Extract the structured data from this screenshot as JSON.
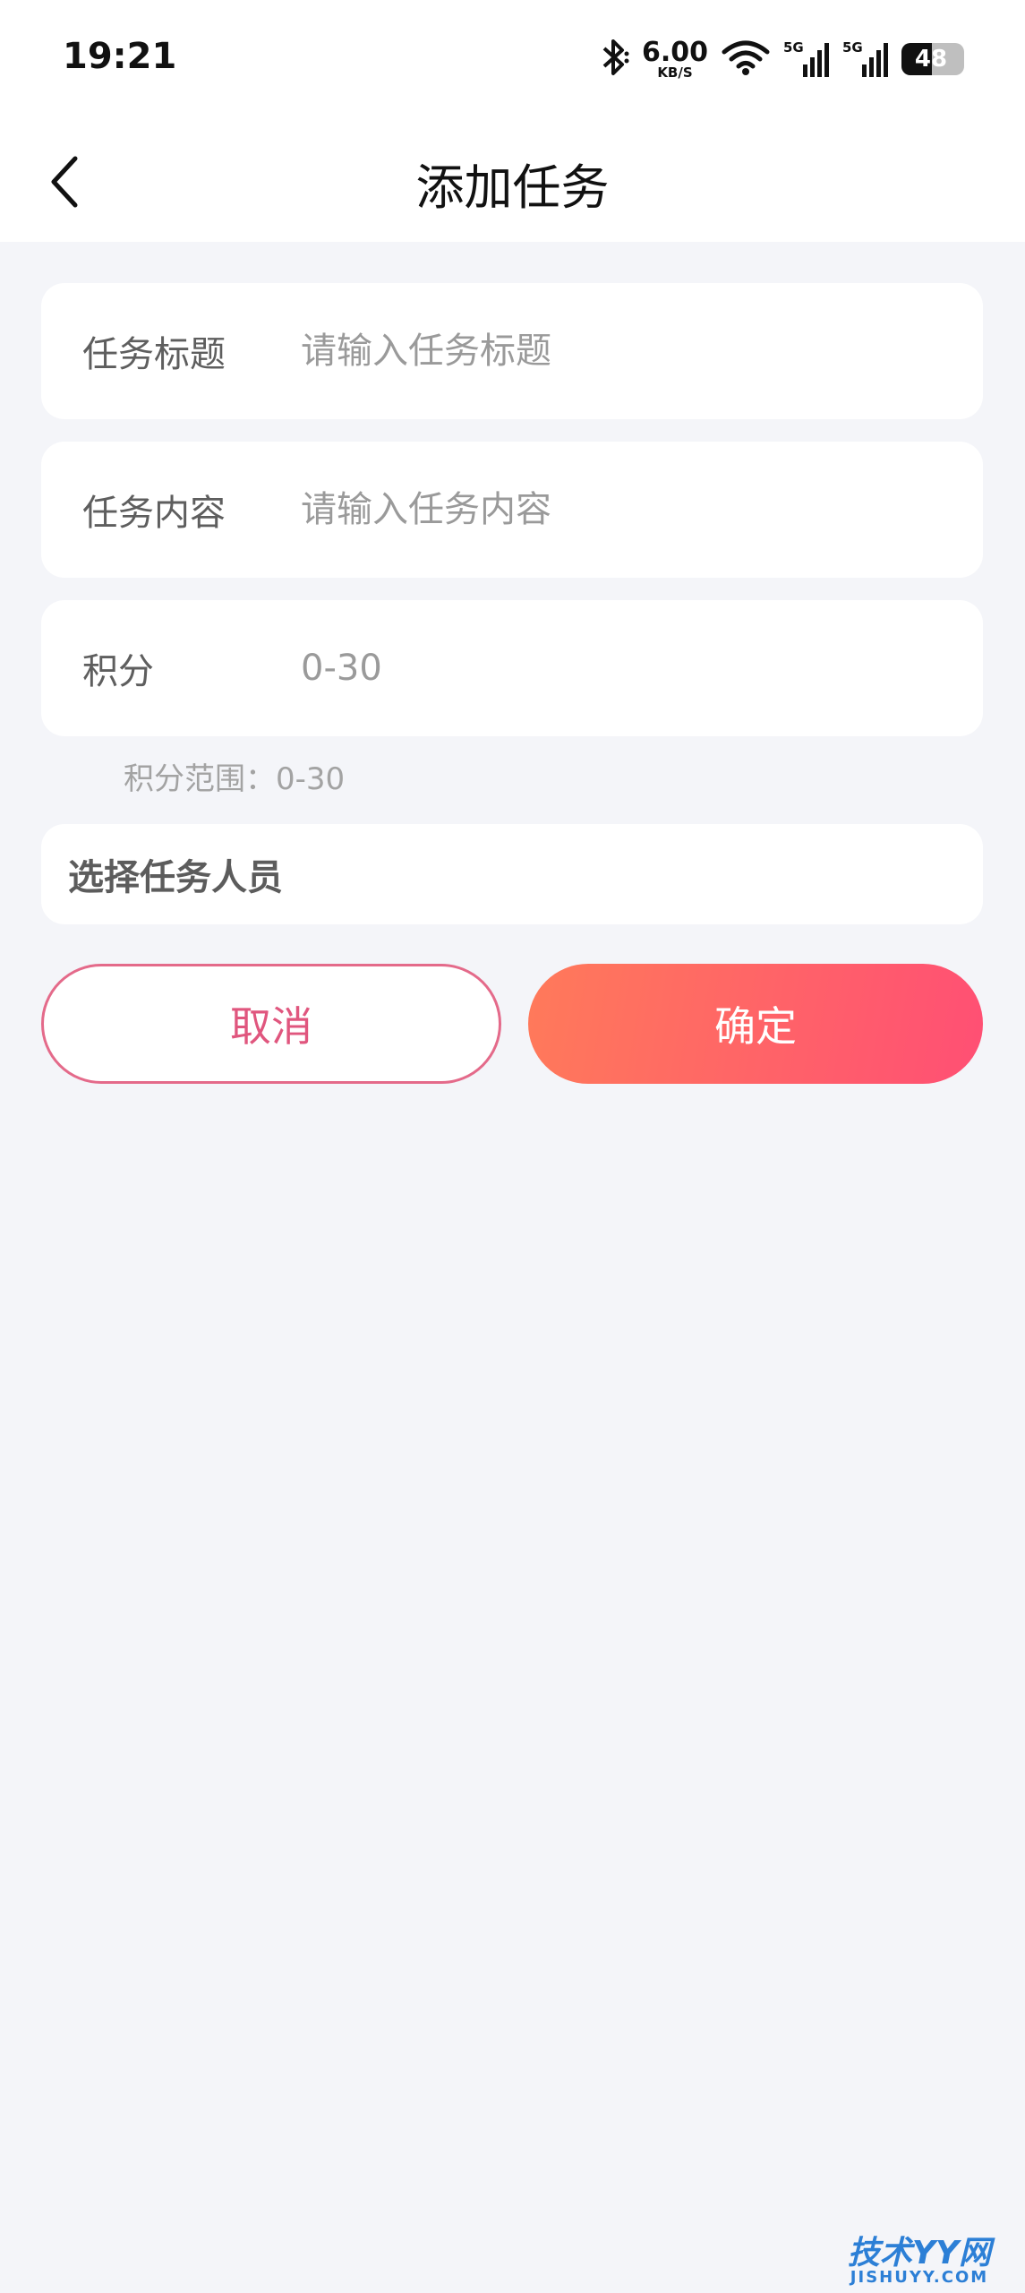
{
  "status_bar": {
    "time": "19:21",
    "net_speed": "6.00",
    "net_unit": "KB/S",
    "sim1_label": "5G",
    "sim2_label": "5G",
    "battery_level": "48",
    "battery_fraction": 0.48,
    "icons": [
      "bluetooth-icon",
      "wifi-icon",
      "signal-icon",
      "battery-icon"
    ]
  },
  "nav": {
    "title": "添加任务",
    "back_icon": "chevron-left-icon"
  },
  "form": {
    "title_field": {
      "label": "任务标题",
      "placeholder": "请输入任务标题",
      "value": ""
    },
    "content_field": {
      "label": "任务内容",
      "placeholder": "请输入任务内容",
      "value": ""
    },
    "points_field": {
      "label": "积分",
      "placeholder": "0-30",
      "value": ""
    },
    "points_hint": "积分范围：0-30",
    "select_members_label": "选择任务人员"
  },
  "actions": {
    "cancel_label": "取消",
    "confirm_label": "确定"
  },
  "watermark": {
    "main": "技术YY网",
    "sub": "JISHUYY.COM"
  },
  "colors": {
    "background": "#f4f5f9",
    "accent_pink": "#e0567e",
    "gradient_start": "#ff7a5a",
    "gradient_end": "#ff4f74"
  }
}
